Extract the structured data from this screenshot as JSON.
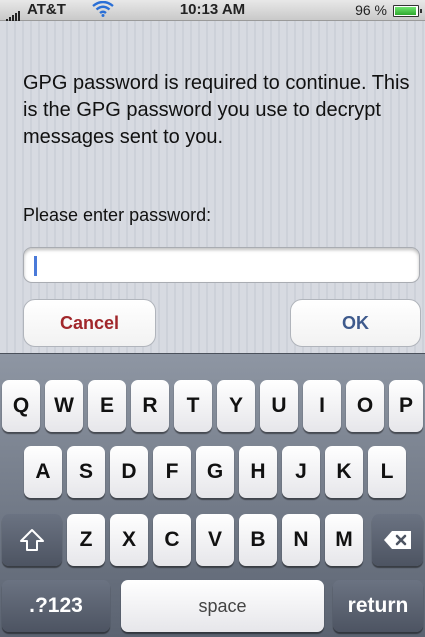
{
  "status_bar": {
    "carrier": "AT&T",
    "time": "10:13 AM",
    "battery_percent": "96 %"
  },
  "dialog": {
    "message": "GPG password is required to continue. This is the GPG password you use to decrypt messages sent to you.",
    "password_label": "Please enter password:",
    "password_value": "",
    "cancel_label": "Cancel",
    "ok_label": "OK"
  },
  "keyboard": {
    "row1": [
      "Q",
      "W",
      "E",
      "R",
      "T",
      "Y",
      "U",
      "I",
      "O",
      "P"
    ],
    "row2": [
      "A",
      "S",
      "D",
      "F",
      "G",
      "H",
      "J",
      "K",
      "L"
    ],
    "row3": [
      "Z",
      "X",
      "C",
      "V",
      "B",
      "N",
      "M"
    ],
    "numbers_label": ".?123",
    "space_label": "space",
    "return_label": "return",
    "shift_icon": "shift-icon",
    "delete_icon": "backspace-icon"
  },
  "colors": {
    "cancel_text": "#a1272b",
    "ok_text": "#3e5a8c",
    "caret": "#4a7ad9"
  }
}
